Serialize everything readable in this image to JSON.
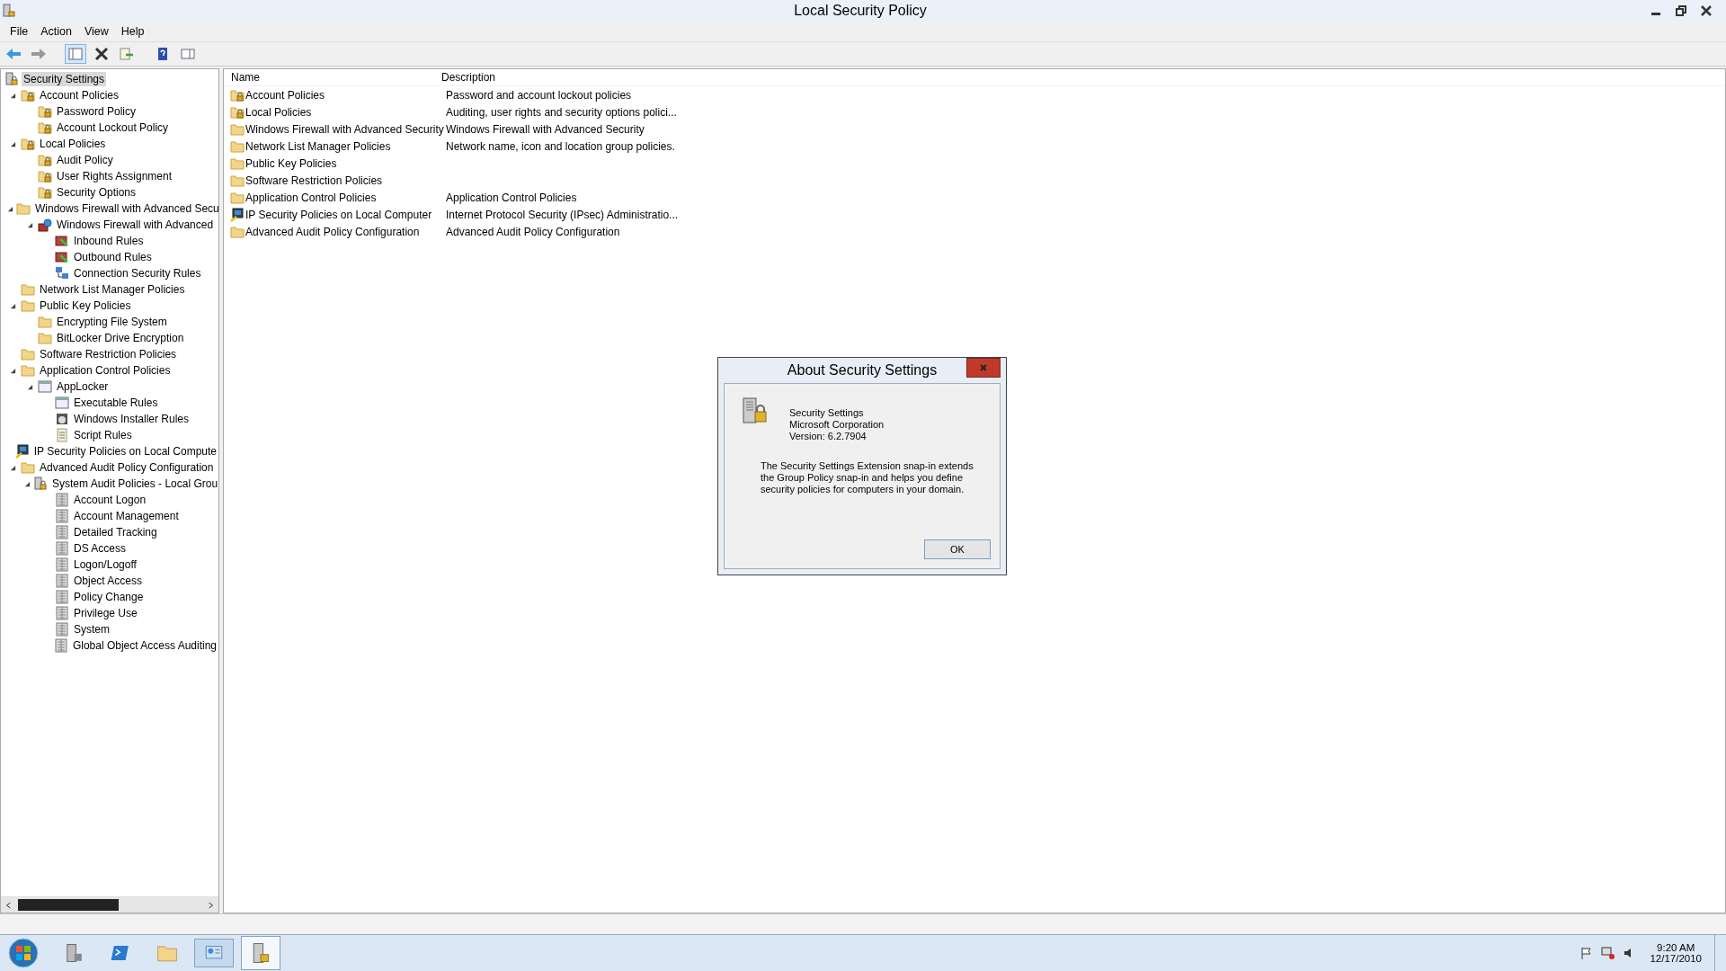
{
  "window": {
    "title": "Local Security Policy"
  },
  "menu": [
    "File",
    "Action",
    "View",
    "Help"
  ],
  "tree": [
    {
      "label": "Security Settings",
      "kind": "policy",
      "selected": true,
      "children": [
        {
          "label": "Account Policies",
          "kind": "locked-folder",
          "selected": false,
          "expanded": true,
          "children": [
            {
              "label": "Password Policy",
              "kind": "locked-folder",
              "selected": false
            },
            {
              "label": "Account Lockout Policy",
              "kind": "locked-folder",
              "selected": false
            }
          ]
        },
        {
          "label": "Local Policies",
          "kind": "locked-folder",
          "selected": false,
          "expanded": true,
          "children": [
            {
              "label": "Audit Policy",
              "kind": "locked-folder",
              "selected": false
            },
            {
              "label": "User Rights Assignment",
              "kind": "locked-folder",
              "selected": false
            },
            {
              "label": "Security Options",
              "kind": "locked-folder",
              "selected": false
            }
          ]
        },
        {
          "label": "Windows Firewall with Advanced Secu",
          "kind": "folder",
          "selected": false,
          "expanded": true,
          "children": [
            {
              "label": "Windows Firewall with Advanced",
              "kind": "firewall",
              "selected": false,
              "expanded": true,
              "children": [
                {
                  "label": "Inbound Rules",
                  "kind": "wall",
                  "selected": false
                },
                {
                  "label": "Outbound Rules",
                  "kind": "wall",
                  "selected": false
                },
                {
                  "label": "Connection Security Rules",
                  "kind": "network",
                  "selected": false
                }
              ]
            }
          ]
        },
        {
          "label": "Network List Manager Policies",
          "kind": "folder",
          "selected": false
        },
        {
          "label": "Public Key Policies",
          "kind": "folder",
          "selected": false,
          "expanded": true,
          "children": [
            {
              "label": "Encrypting File System",
              "kind": "folder",
              "selected": false
            },
            {
              "label": "BitLocker Drive Encryption",
              "kind": "folder",
              "selected": false
            }
          ]
        },
        {
          "label": "Software Restriction Policies",
          "kind": "folder",
          "selected": false
        },
        {
          "label": "Application Control Policies",
          "kind": "folder",
          "selected": false,
          "expanded": true,
          "children": [
            {
              "label": "AppLocker",
              "kind": "window",
              "selected": false,
              "expanded": true,
              "children": [
                {
                  "label": "Executable Rules",
                  "kind": "window",
                  "selected": false
                },
                {
                  "label": "Windows Installer Rules",
                  "kind": "disk",
                  "selected": false
                },
                {
                  "label": "Script Rules",
                  "kind": "script",
                  "selected": false
                }
              ]
            }
          ]
        },
        {
          "label": "IP Security Policies on Local Compute",
          "kind": "computer",
          "selected": false
        },
        {
          "label": "Advanced Audit Policy Configuration",
          "kind": "folder",
          "selected": false,
          "expanded": true,
          "children": [
            {
              "label": "System Audit Policies - Local Grou",
              "kind": "policy",
              "selected": false,
              "expanded": true,
              "children": [
                {
                  "label": "Account Logon",
                  "kind": "audit",
                  "selected": false
                },
                {
                  "label": "Account Management",
                  "kind": "audit",
                  "selected": false
                },
                {
                  "label": "Detailed Tracking",
                  "kind": "audit",
                  "selected": false
                },
                {
                  "label": "DS Access",
                  "kind": "audit",
                  "selected": false
                },
                {
                  "label": "Logon/Logoff",
                  "kind": "audit",
                  "selected": false
                },
                {
                  "label": "Object Access",
                  "kind": "audit",
                  "selected": false
                },
                {
                  "label": "Policy Change",
                  "kind": "audit",
                  "selected": false
                },
                {
                  "label": "Privilege Use",
                  "kind": "audit",
                  "selected": false
                },
                {
                  "label": "System",
                  "kind": "audit",
                  "selected": false
                },
                {
                  "label": "Global Object Access Auditing",
                  "kind": "audit",
                  "selected": false
                }
              ]
            }
          ]
        }
      ]
    }
  ],
  "table": {
    "columns": [
      "Name",
      "Description"
    ],
    "rows": [
      {
        "name": "Account Policies",
        "kind": "locked-folder",
        "description": "Password and account lockout policies"
      },
      {
        "name": "Local Policies",
        "kind": "locked-folder",
        "description": "Auditing, user rights and security options polici..."
      },
      {
        "name": "Windows Firewall with Advanced Security",
        "kind": "folder",
        "description": "Windows Firewall with Advanced Security"
      },
      {
        "name": "Network List Manager Policies",
        "kind": "folder",
        "description": "Network name, icon and location group policies."
      },
      {
        "name": "Public Key Policies",
        "kind": "folder"
      },
      {
        "name": "Software Restriction Policies",
        "kind": "folder"
      },
      {
        "name": "Application Control Policies",
        "kind": "folder",
        "description": "Application Control Policies"
      },
      {
        "name": "IP Security Policies on Local Computer",
        "kind": "computer",
        "description": "Internet Protocol Security (IPsec) Administratio..."
      },
      {
        "name": "Advanced Audit Policy Configuration",
        "kind": "folder",
        "description": "Advanced Audit Policy Configuration"
      }
    ]
  },
  "dialog": {
    "title": "About Security Settings",
    "product": "Security Settings",
    "company": "Microsoft Corporation",
    "version": "Version: 6.2.7904",
    "description": "The Security Settings Extension snap-in extends the Group Policy snap-in and helps you define security policies for computers in your domain.",
    "button": "OK"
  },
  "taskbar": {
    "time": "9:20 AM",
    "date": "12/17/2010"
  }
}
